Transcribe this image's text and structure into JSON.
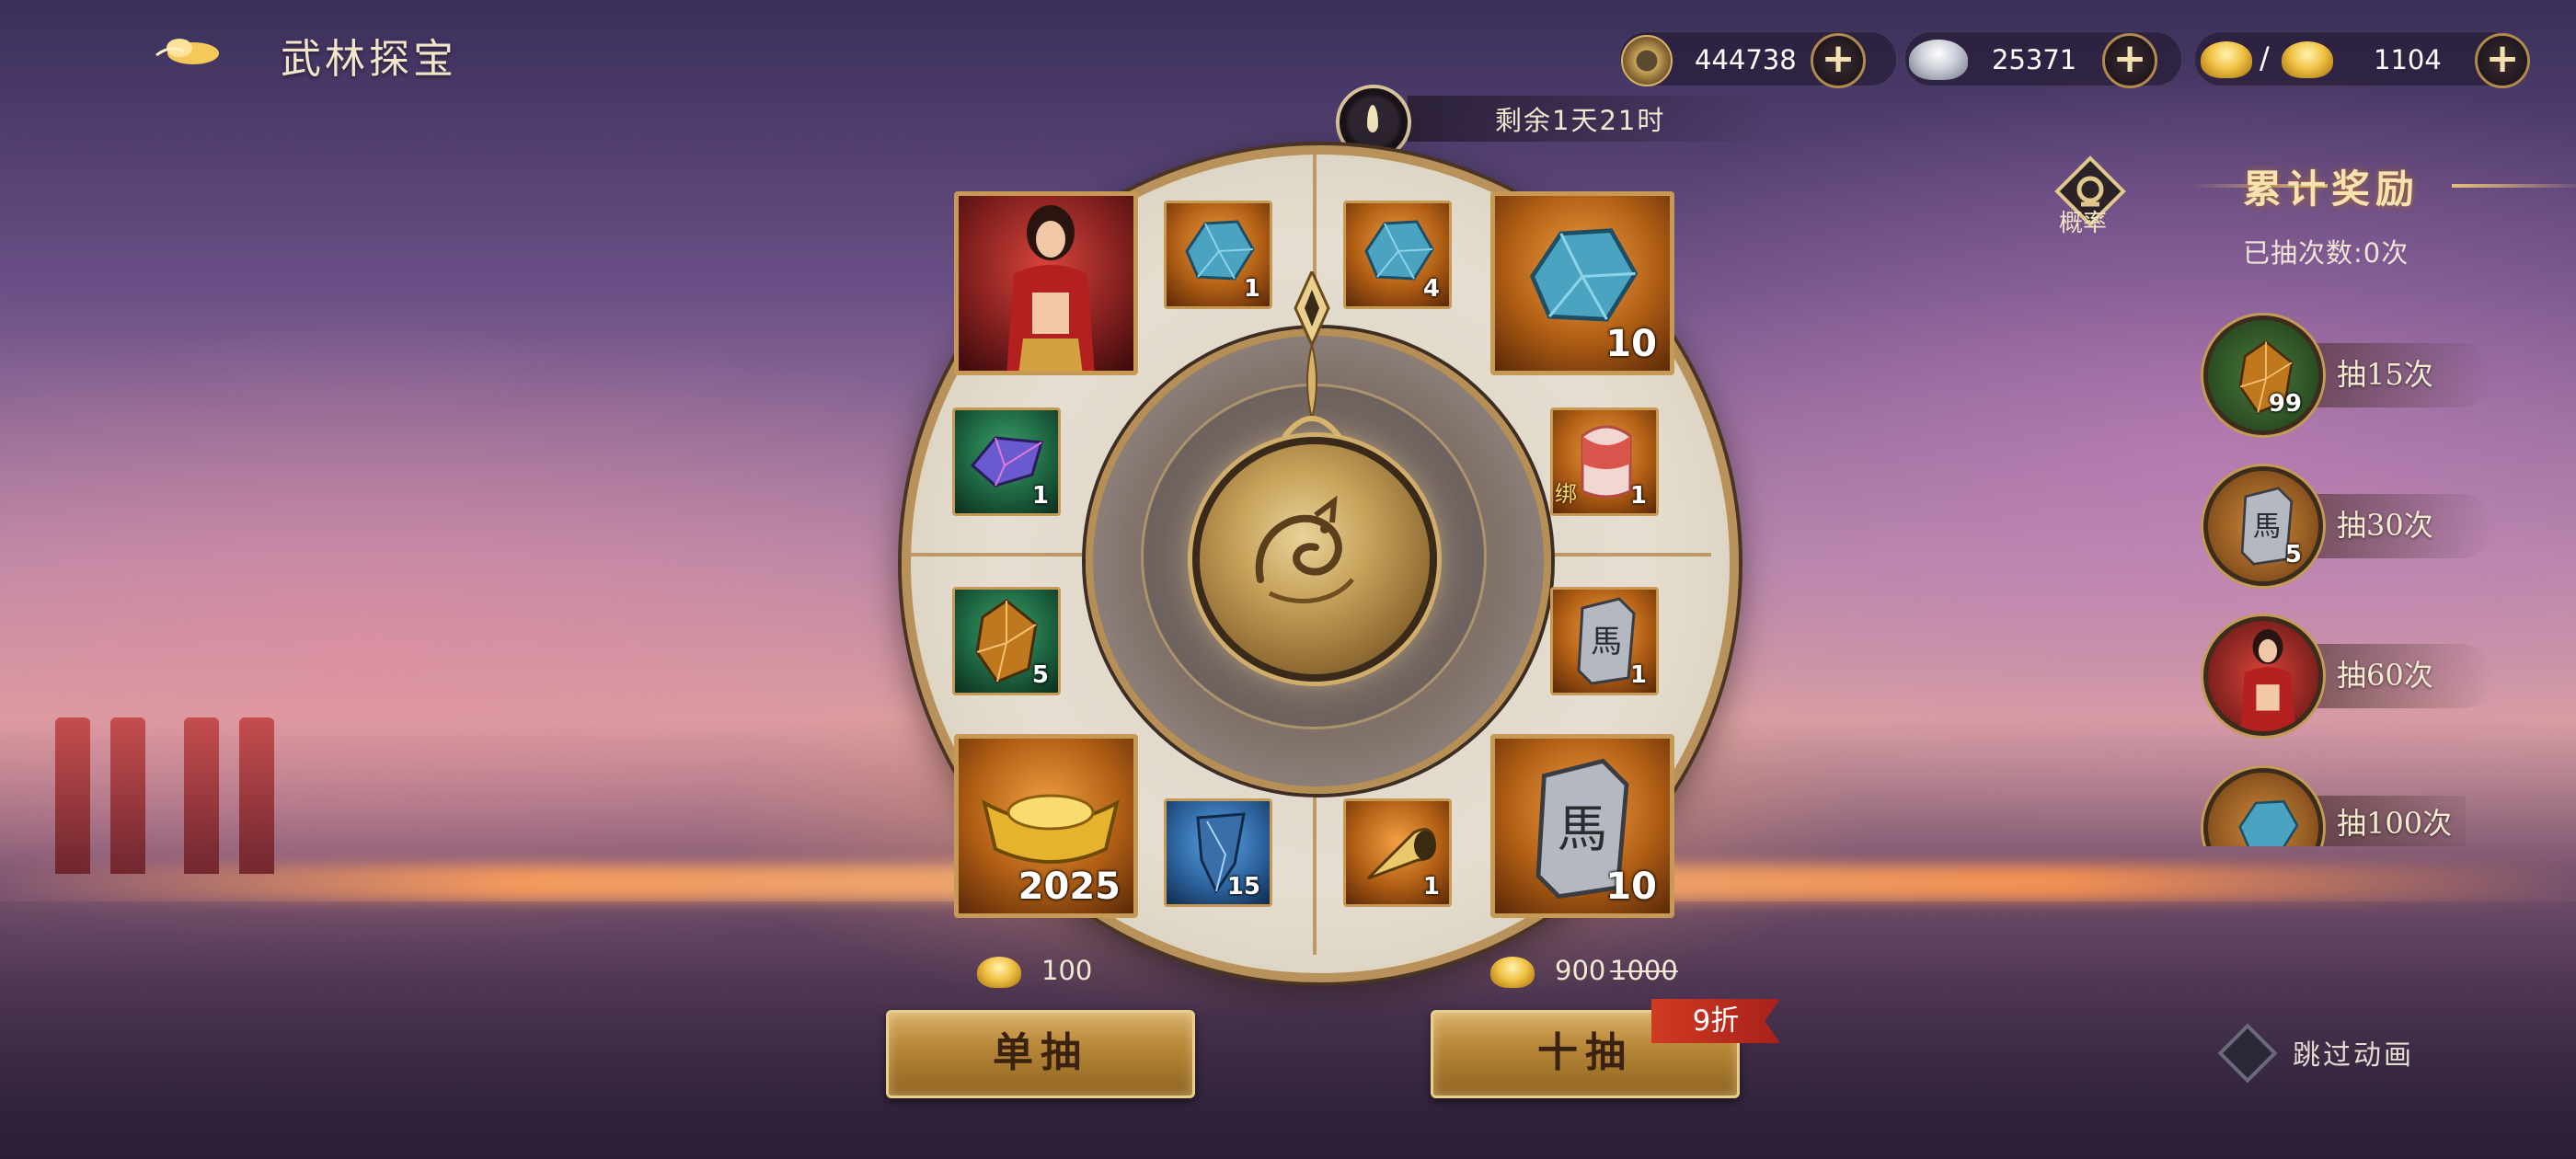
{
  "header": {
    "title": "武林探宝"
  },
  "currencies": [
    {
      "icon": "copper-coin-icon",
      "value": "444738"
    },
    {
      "icon": "silver-ingot-icon",
      "value": "25371"
    },
    {
      "icon": "gold-ingot-pair-icon",
      "separator": "/",
      "value": "1104"
    }
  ],
  "timer": {
    "text": "剩余1天21时"
  },
  "wheel": {
    "items": [
      {
        "name": "character-card-red",
        "qty": ""
      },
      {
        "name": "blue-ore-small",
        "qty": "1"
      },
      {
        "name": "blue-ore-small-2",
        "qty": "4"
      },
      {
        "name": "blue-ore-large",
        "qty": "10"
      },
      {
        "name": "purple-crystal",
        "qty": "1"
      },
      {
        "name": "red-seal-bound",
        "qty": "1",
        "tag": "绑"
      },
      {
        "name": "amber-crystal",
        "qty": "5"
      },
      {
        "name": "horse-token-small",
        "qty": "1"
      },
      {
        "name": "gold-ingot-large",
        "qty": "2025"
      },
      {
        "name": "blue-shard",
        "qty": "15"
      },
      {
        "name": "gold-horn",
        "qty": "1"
      },
      {
        "name": "horse-token-large",
        "qty": "10"
      }
    ]
  },
  "draw": {
    "single": {
      "cost": "100",
      "label": "单抽"
    },
    "ten": {
      "cost": "900",
      "original_cost": "1000",
      "label": "十抽",
      "discount": "9折"
    }
  },
  "cumulative": {
    "probability_label": "概率",
    "title": "累计奖励",
    "drawn_count": "已抽次数:0次",
    "milestones": [
      {
        "label": "抽15次",
        "qty": "99",
        "icon": "amber-crystal-icon"
      },
      {
        "label": "抽30次",
        "qty": "5",
        "icon": "horse-token-icon"
      },
      {
        "label": "抽60次",
        "qty": "",
        "icon": "character-portrait-icon"
      },
      {
        "label": "抽100次",
        "qty": "",
        "icon": "blue-ore-icon"
      }
    ]
  },
  "skip_animation": {
    "label": "跳过动画"
  }
}
